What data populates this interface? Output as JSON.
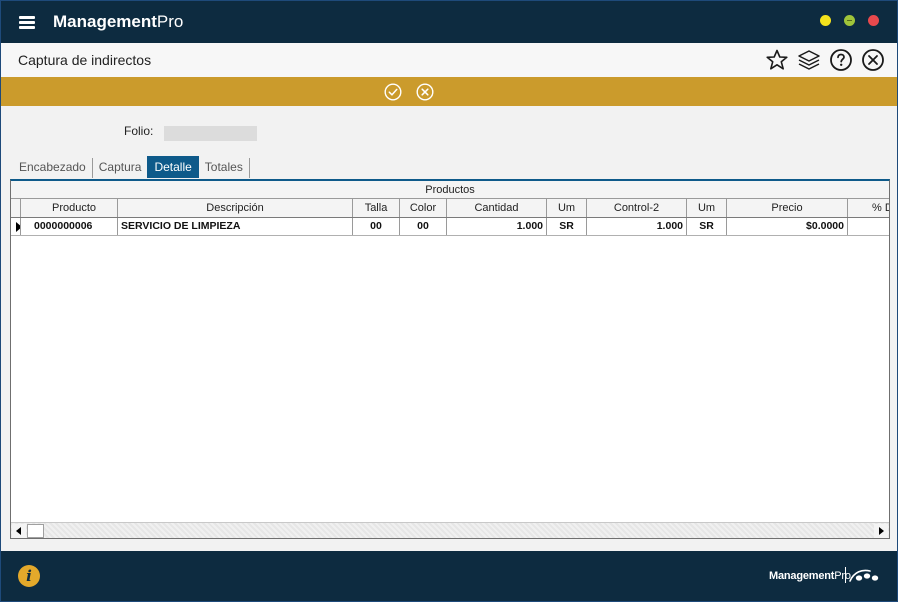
{
  "app": {
    "brand_bold": "Management",
    "brand_light": "Pro"
  },
  "module": {
    "title": "Captura de indirectos"
  },
  "header_icons": [
    "star-icon",
    "layers-icon",
    "help-icon",
    "close-circle-icon"
  ],
  "actions": [
    "check-circle-icon",
    "cancel-circle-icon"
  ],
  "form": {
    "folio_label": "Folio:",
    "folio_value": ""
  },
  "tabs": [
    {
      "label": "Encabezado",
      "active": false
    },
    {
      "label": "Captura",
      "active": false
    },
    {
      "label": "Detalle",
      "active": true
    },
    {
      "label": "Totales",
      "active": false
    }
  ],
  "grid": {
    "band_title": "Productos",
    "columns": [
      "Producto",
      "Descripción",
      "Talla",
      "Color",
      "Cantidad",
      "Um",
      "Control-2",
      "Um",
      "Precio",
      "% D"
    ],
    "rows": [
      [
        "0000000006",
        "SERVICIO DE LIMPIEZA",
        "00",
        "00",
        "1.000",
        "SR",
        "1.000",
        "SR",
        "$0.0000",
        ""
      ]
    ]
  },
  "footer": {
    "info_glyph": "i",
    "brand_bold": "Management",
    "brand_light": "Pro"
  },
  "colors": {
    "titlebar": "#0d2b40",
    "accent_gold": "#cb9b2c",
    "active_tab": "#0e5a8a",
    "info_icon": "#e3a92b"
  }
}
